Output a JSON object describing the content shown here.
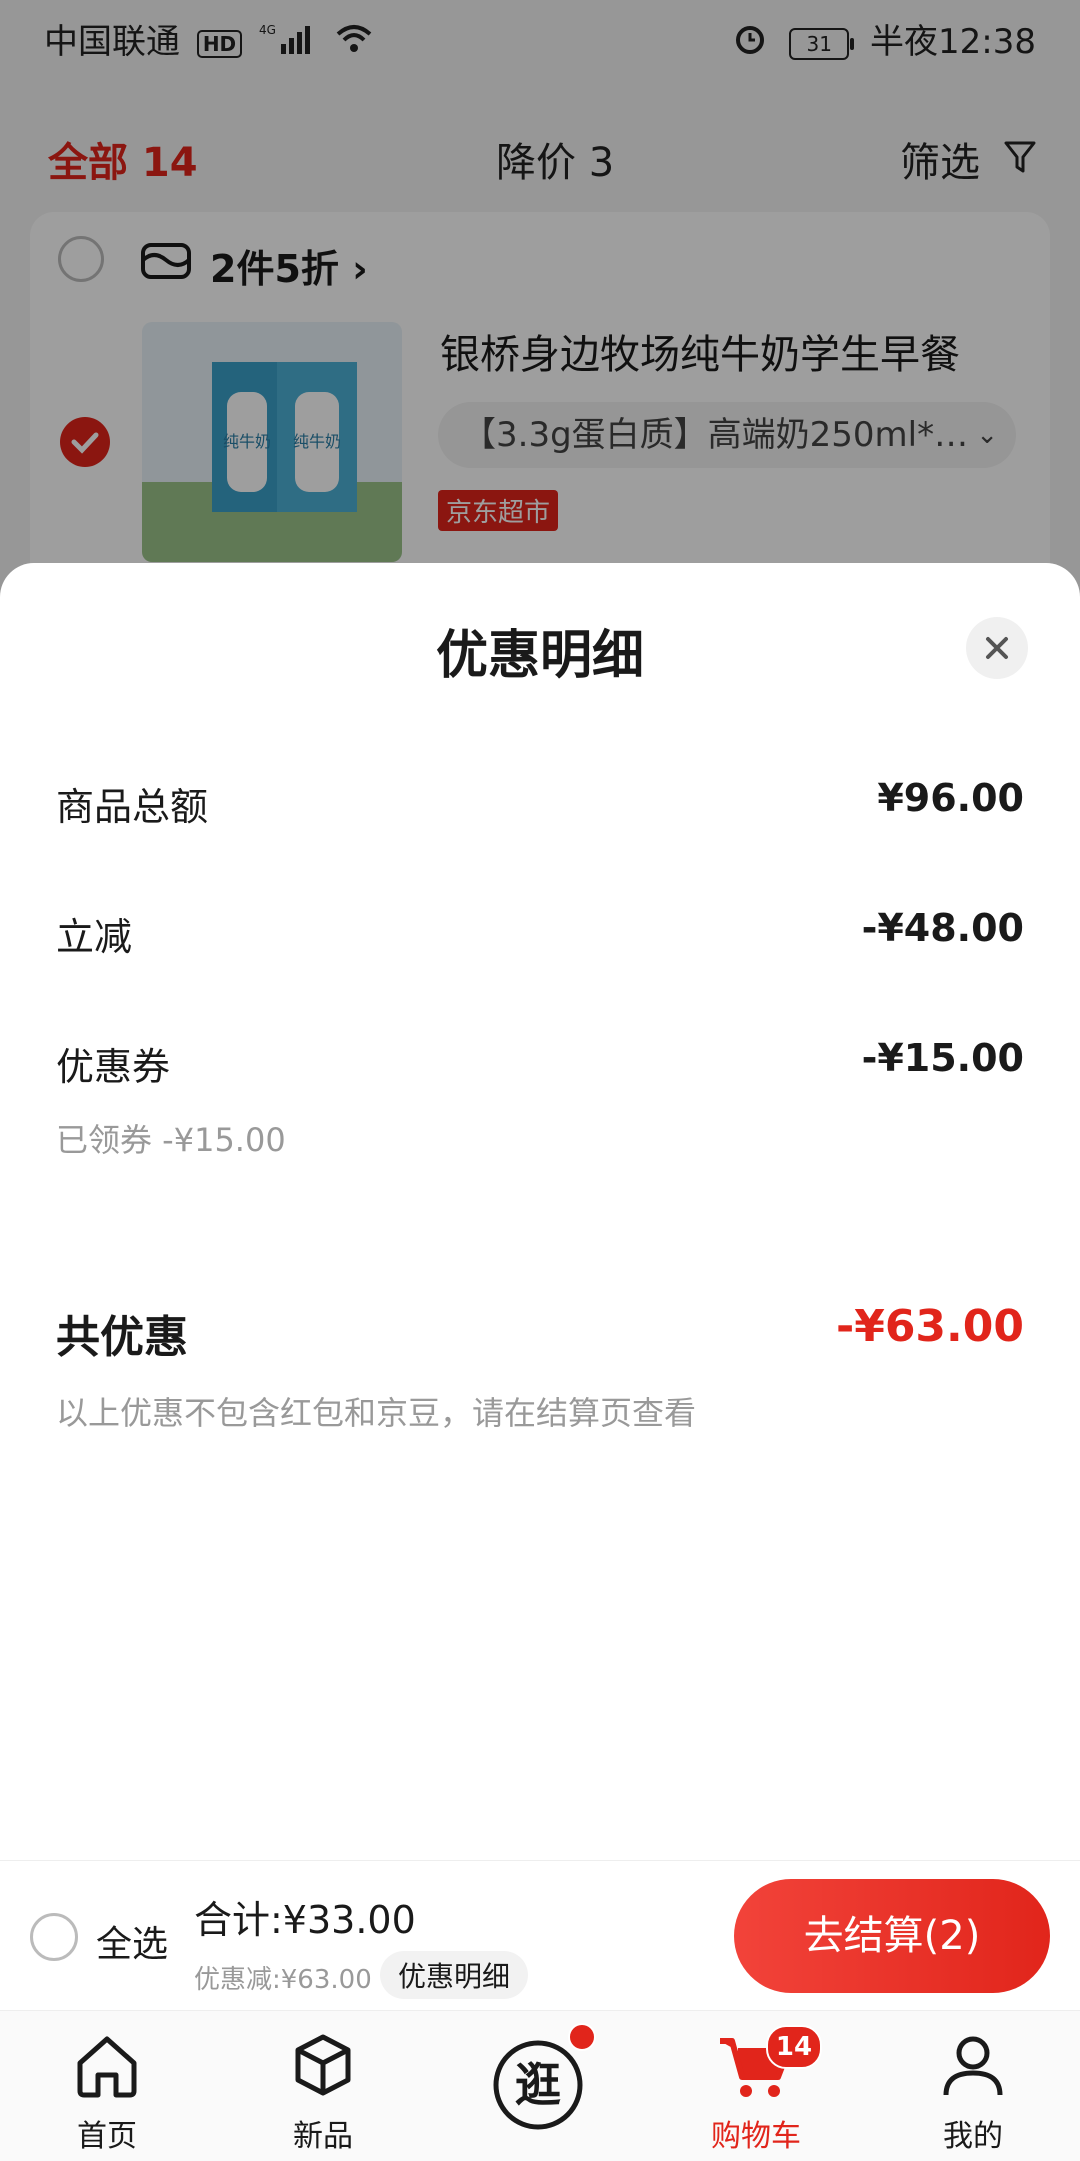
{
  "status_bar": {
    "carrier": "中国联通",
    "hd": "HD",
    "network": "4G",
    "battery": "31",
    "time": "半夜12:38"
  },
  "tabs": {
    "all": "全部 14",
    "price_drop": "降价 3",
    "filter": "筛选"
  },
  "cart_item": {
    "promo": "2件5折 ›",
    "title": "银桥身边牧场纯牛奶学生早餐",
    "spec": "【3.3g蛋白质】高端奶250ml*…",
    "tag": "京东超市",
    "package_text": "纯牛奶"
  },
  "sheet": {
    "title": "优惠明细",
    "rows": [
      {
        "label": "商品总额",
        "value": "¥96.00"
      },
      {
        "label": "立减",
        "value": "-¥48.00"
      },
      {
        "label": "优惠券",
        "value": "-¥15.00",
        "sub": "已领券 -¥15.00"
      }
    ],
    "total_label": "共优惠",
    "total_value": "-¥63.00",
    "note": "以上优惠不包含红包和京豆，请在结算页查看"
  },
  "checkout": {
    "select_all": "全选",
    "sum": "合计:¥33.00",
    "discount": "优惠减:¥63.00",
    "detail_chip": "优惠明细",
    "button": "去结算(2)"
  },
  "nav": {
    "items": [
      {
        "label": "首页",
        "icon": "home-icon"
      },
      {
        "label": "新品",
        "icon": "cube-icon"
      },
      {
        "label": "逛",
        "icon": "explore-icon"
      },
      {
        "label": "购物车",
        "icon": "cart-icon",
        "badge": "14"
      },
      {
        "label": "我的",
        "icon": "user-icon"
      }
    ]
  },
  "colors": {
    "accent": "#e1251b",
    "muted": "#999999"
  }
}
